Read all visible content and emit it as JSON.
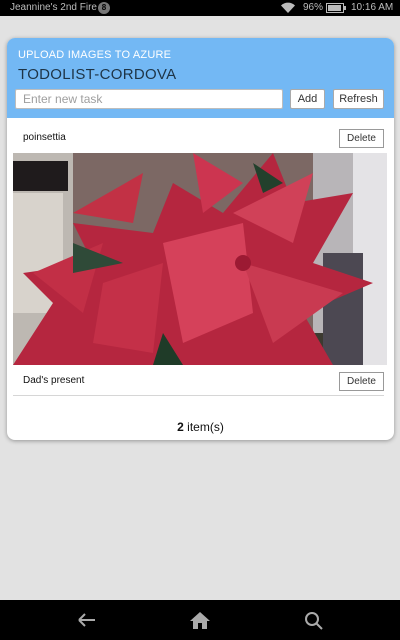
{
  "status_bar": {
    "device_name": "Jeannine's 2nd Fire",
    "notification_count": "8",
    "battery_percent": "96%",
    "time": "10:16 AM"
  },
  "header": {
    "subtitle": "UPLOAD IMAGES TO AZURE",
    "title": "TODOLIST-CORDOVA",
    "input_placeholder": "Enter new task",
    "input_value": "",
    "add_label": "Add",
    "refresh_label": "Refresh"
  },
  "todo_items": [
    {
      "text": "poinsettia",
      "delete_label": "Delete",
      "has_image": true
    },
    {
      "text": "Dad's present",
      "delete_label": "Delete",
      "has_image": false
    }
  ],
  "footer": {
    "count": "2",
    "count_suffix": " item(s)"
  },
  "colors": {
    "header_bg": "#73b8f4",
    "title_text": "#1e3446",
    "page_bg": "#e2e2e2"
  },
  "icons": {
    "status": [
      "wifi-icon",
      "battery-icon"
    ],
    "nav": [
      "back-icon",
      "home-icon",
      "search-icon"
    ]
  }
}
